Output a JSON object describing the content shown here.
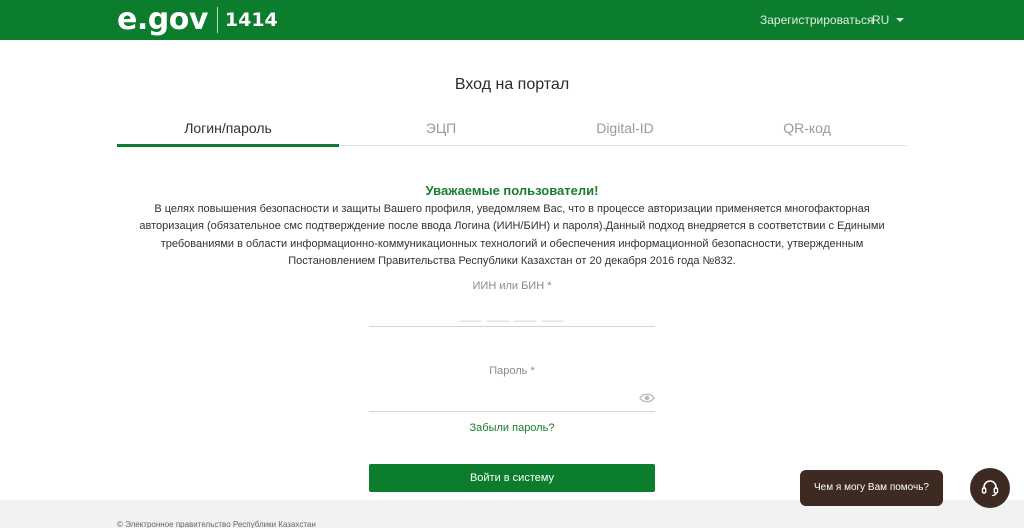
{
  "header": {
    "logo_text": "e.gov",
    "phone": "1414",
    "register_label": "Зарегистрироваться",
    "language": "RU"
  },
  "page_title": "Вход на портал",
  "tabs": [
    {
      "label": "Логин/пароль",
      "active": true
    },
    {
      "label": "ЭЦП",
      "active": false
    },
    {
      "label": "Digital-ID",
      "active": false
    },
    {
      "label": "QR-код",
      "active": false
    }
  ],
  "notice": {
    "title": "Уважаемые пользователи!",
    "text": "В целях повышения безопасности и защиты Вашего профиля, уведомляем Вас, что в процессе авторизации применяется многофакторная авторизация (обязательное смс подтверждение после ввода Логина (ИИН/БИН) и пароля).Данный подход внедряется в соответствии с Едиными требованиями в области информационно-коммуникационных технологий и обеспечения информационной безопасности, утвержденным Постановлением Правительства Республики Казахстан от 20 декабря 2016 года №832."
  },
  "form": {
    "iin_label": "ИИН или БИН *",
    "iin_placeholder": "___ ___ ___ ___",
    "iin_value": "",
    "password_label": "Пароль *",
    "password_value": "",
    "forgot_label": "Забыли пароль?",
    "submit_label": "Войти в систему"
  },
  "footer": {
    "text": "© Электронное правительство Республики Казахстан"
  },
  "chat": {
    "prompt": "Чем я могу Вам помочь?"
  },
  "colors": {
    "brand_green": "#0b7d2c",
    "chat_brown": "#3d2b22"
  }
}
